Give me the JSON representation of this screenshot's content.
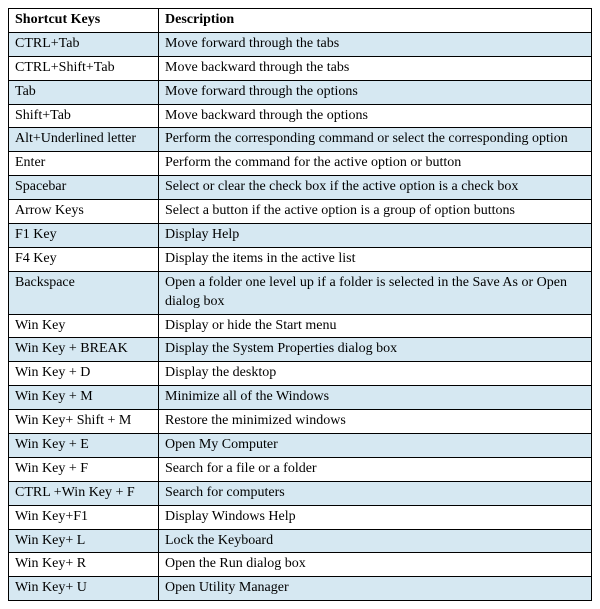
{
  "headers": {
    "key": "Shortcut Keys",
    "desc": "Description"
  },
  "rows": [
    {
      "key": "CTRL+Tab",
      "desc": "Move forward through the tabs",
      "alt": true
    },
    {
      "key": "CTRL+Shift+Tab",
      "desc": "Move backward through the tabs",
      "alt": false
    },
    {
      "key": "Tab",
      "desc": "Move forward through the options",
      "alt": true
    },
    {
      "key": "Shift+Tab",
      "desc": "Move backward through the options",
      "alt": false
    },
    {
      "key": "Alt+Underlined letter",
      "desc": "Perform the corresponding command or select the corresponding option",
      "alt": true,
      "justify": true
    },
    {
      "key": "Enter",
      "desc": "Perform the command for the active option or button",
      "alt": false
    },
    {
      "key": "Spacebar",
      "desc": "Select or clear the check box if the active option is a check box",
      "alt": true
    },
    {
      "key": "Arrow Keys",
      "desc": "Select a button if the active option is a group of option buttons",
      "alt": false
    },
    {
      "key": "F1 Key",
      "desc": "Display Help",
      "alt": true
    },
    {
      "key": "F4 Key",
      "desc": "Display the items in the active list",
      "alt": false
    },
    {
      "key": "Backspace",
      "desc": "Open a folder one level up if a folder is selected in the Save As or Open dialog box",
      "alt": true
    },
    {
      "key": "Win Key",
      "desc": "Display or hide the Start menu",
      "alt": false
    },
    {
      "key": "Win Key + BREAK",
      "desc": "Display the System Properties dialog box",
      "alt": true
    },
    {
      "key": "Win Key + D",
      "desc": "Display the desktop",
      "alt": false
    },
    {
      "key": "Win Key + M",
      "desc": "Minimize all of the Windows",
      "alt": true
    },
    {
      "key": "Win Key+ Shift + M",
      "desc": "Restore the minimized windows",
      "alt": false
    },
    {
      "key": "Win Key + E",
      "desc": "Open My Computer",
      "alt": true
    },
    {
      "key": "Win Key + F",
      "desc": "Search for a file or a folder",
      "alt": false
    },
    {
      "key": "CTRL +Win Key + F",
      "desc": "Search for computers",
      "alt": true
    },
    {
      "key": "Win Key+F1",
      "desc": "Display Windows Help",
      "alt": false
    },
    {
      "key": "Win Key+ L",
      "desc": "Lock the Keyboard",
      "alt": true
    },
    {
      "key": "Win Key+ R",
      "desc": "Open the Run dialog box",
      "alt": false
    },
    {
      "key": "Win Key+ U",
      "desc": "Open Utility Manager",
      "alt": true
    }
  ]
}
